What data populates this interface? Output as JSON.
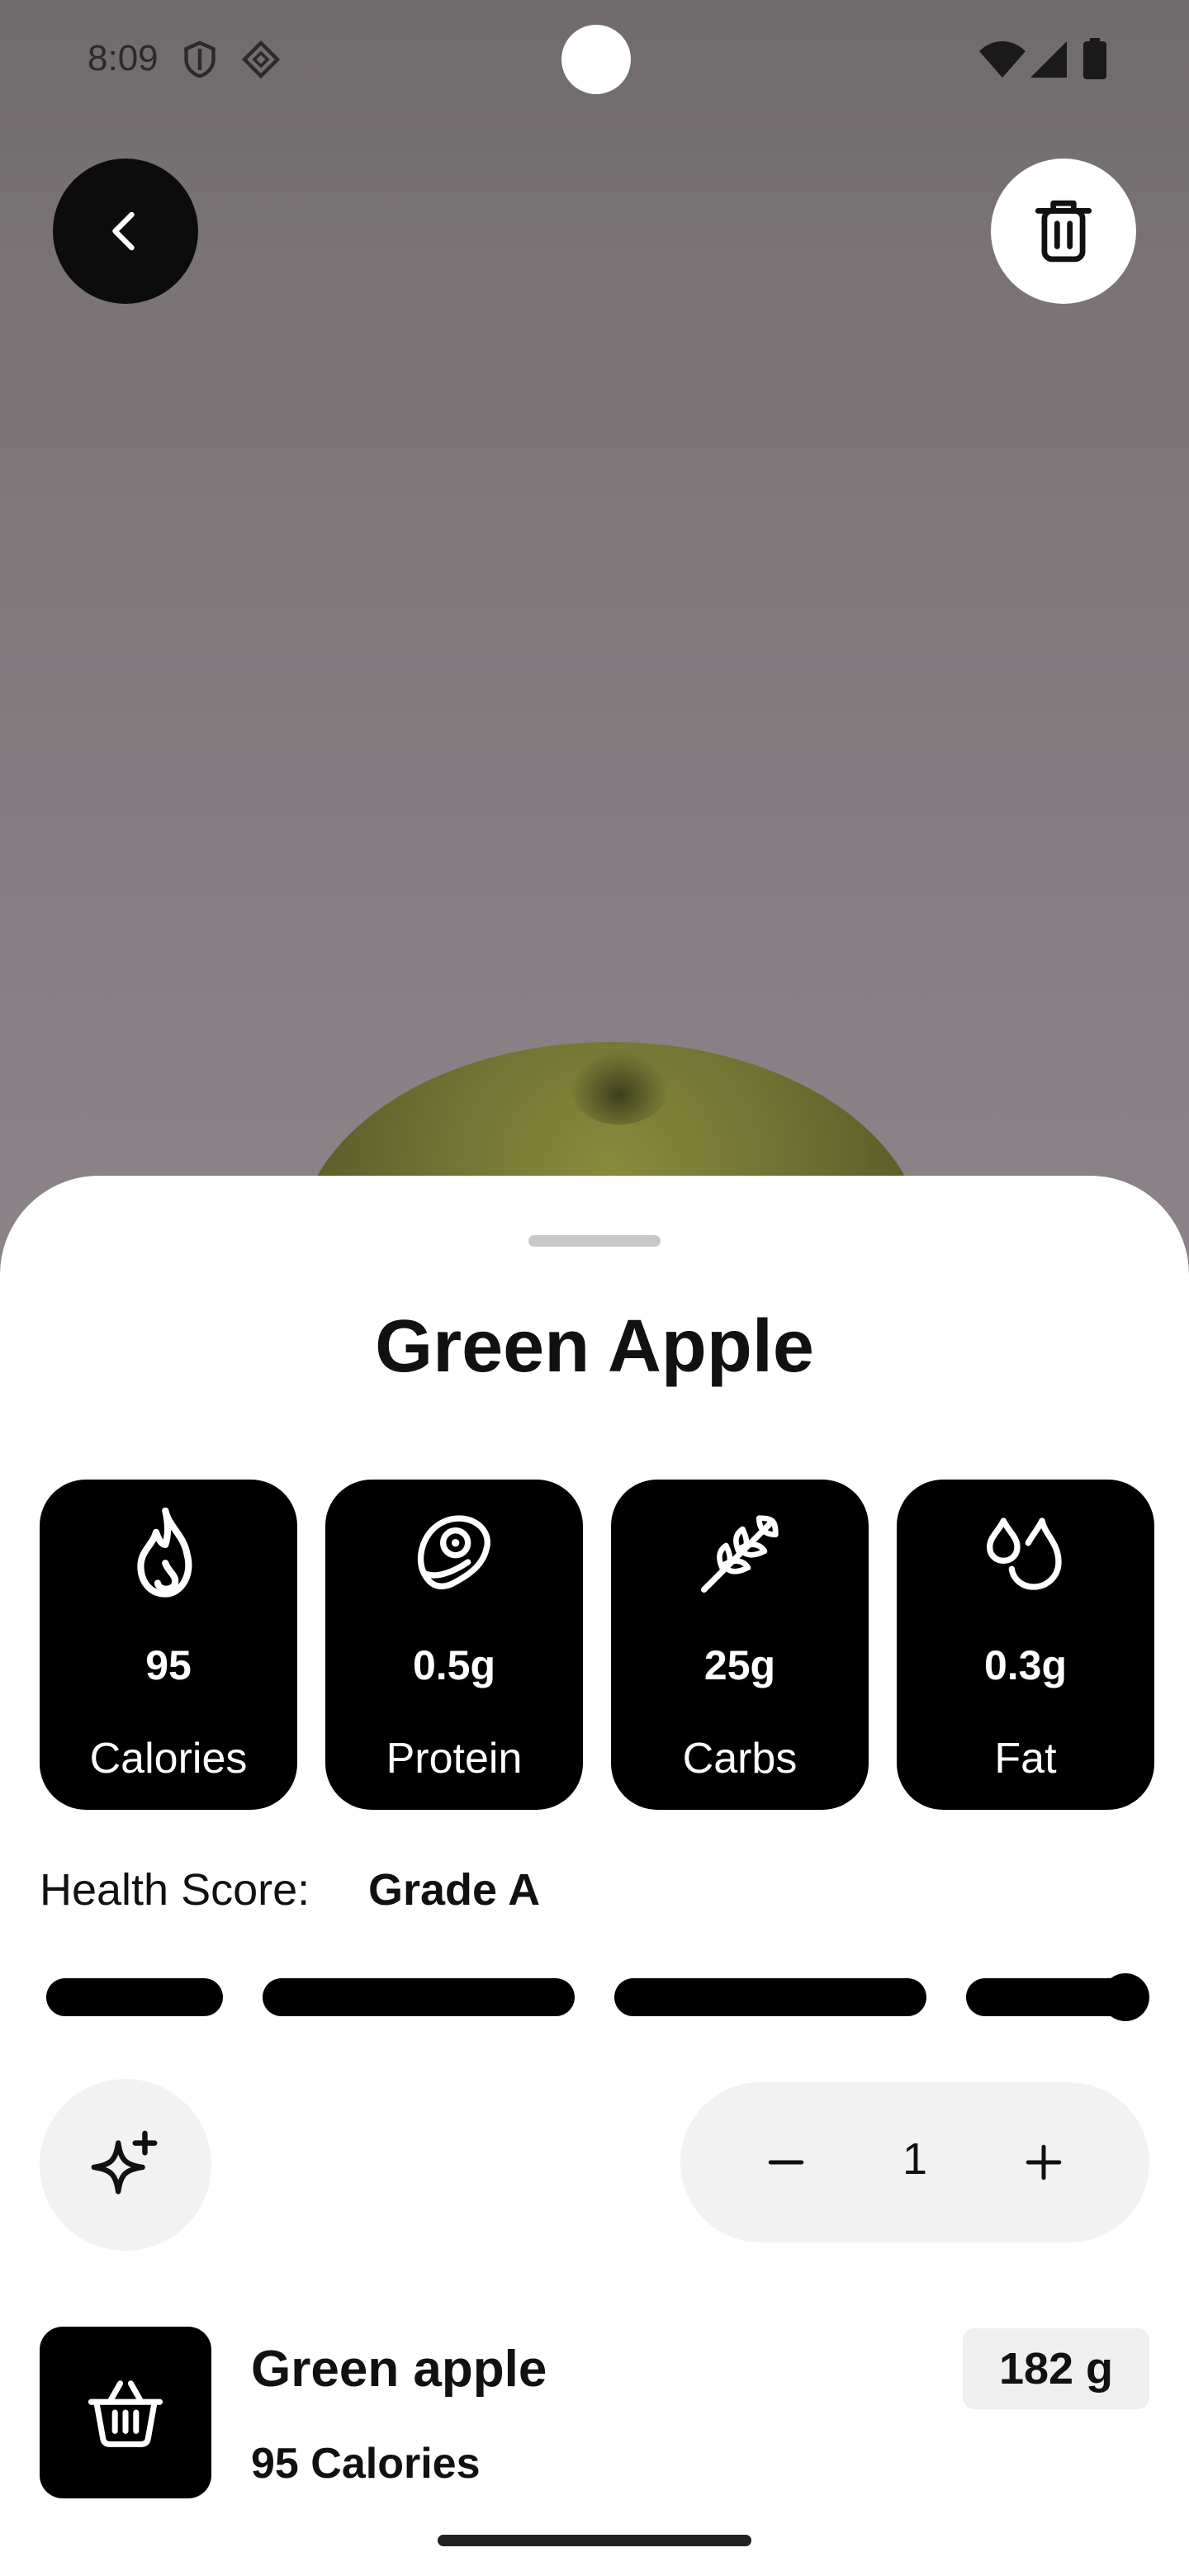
{
  "status_bar": {
    "time": "8:09"
  },
  "header": {
    "back_icon": "chevron-left-icon",
    "delete_icon": "trash-icon"
  },
  "food": {
    "title": "Green Apple"
  },
  "stats": [
    {
      "icon": "flame-icon",
      "value": "95",
      "label": "Calories"
    },
    {
      "icon": "meat-icon",
      "value": "0.5g",
      "label": "Protein"
    },
    {
      "icon": "wheat-icon",
      "value": "25g",
      "label": "Carbs"
    },
    {
      "icon": "drops-icon",
      "value": "0.3g",
      "label": "Fat"
    }
  ],
  "health": {
    "label": "Health Score:",
    "grade": "Grade A",
    "level": 1.0
  },
  "quantity": {
    "value": "1"
  },
  "ingredient": {
    "name": "Green apple",
    "calories": "95 Calories",
    "weight": "182 g",
    "icon": "basket-icon"
  },
  "colors": {
    "accent": "#000000",
    "surface": "#f2f2f2",
    "text": "#111111"
  }
}
